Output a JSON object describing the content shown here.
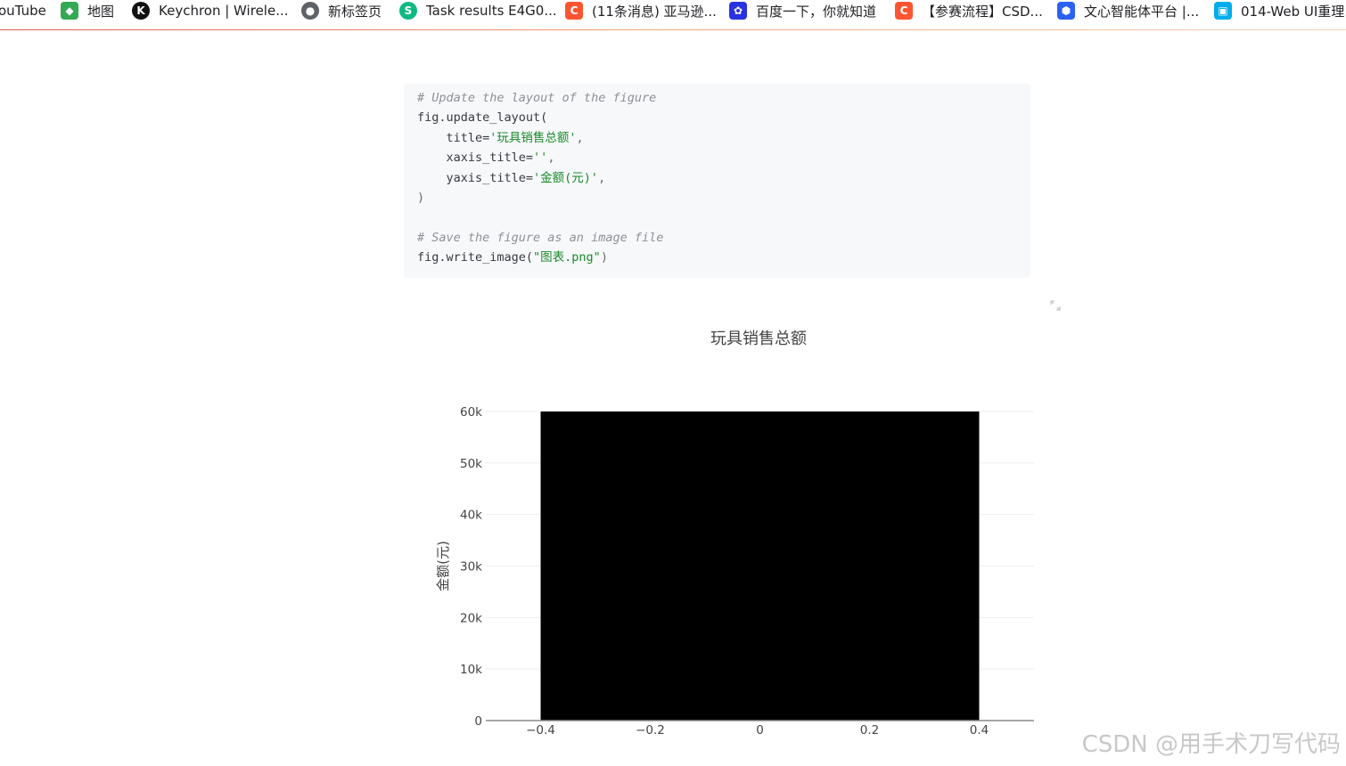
{
  "bookmarks": [
    {
      "label": "ouTube",
      "icon": "youtube-icon",
      "color": "#ff0000"
    },
    {
      "label": "地图",
      "icon": "maps-icon",
      "color": "#34a853"
    },
    {
      "label": "Keychron | Wirele...",
      "icon": "keychron-icon",
      "color": "#111111"
    },
    {
      "label": "新标签页",
      "icon": "globe-icon",
      "color": "#5f6368"
    },
    {
      "label": "Task results E4G0...",
      "icon": "task-icon",
      "color": "#10b981"
    },
    {
      "label": "(11条消息) 亚马逊...",
      "icon": "csdn-icon",
      "color": "#fc5531"
    },
    {
      "label": "百度一下，你就知道",
      "icon": "baidu-icon",
      "color": "#2932e1"
    },
    {
      "label": "【参赛流程】CSD...",
      "icon": "csdn-icon",
      "color": "#fc5531"
    },
    {
      "label": "文心智能体平台 |...",
      "icon": "wenxin-icon",
      "color": "#2b62f4"
    },
    {
      "label": "014-Web UI重理...",
      "icon": "bilibili-icon",
      "color": "#00aeec"
    }
  ],
  "code": {
    "comment1": "# Update the layout of the figure",
    "call1": "fig.update_layout(",
    "arg_title_key": "    title=",
    "arg_title_val": "'玩具销售总额'",
    "arg_x_key": "    xaxis_title=",
    "arg_x_val": "''",
    "arg_y_key": "    yaxis_title=",
    "arg_y_val": "'金额(元)'",
    "comma": ",",
    "close": ")",
    "comment2": "# Save the figure as an image file",
    "call2": "fig.write_image(",
    "call2_arg": "\"图表.png\"",
    "call2_close": ")"
  },
  "watermark": "CSDN @用手术刀写代码",
  "chart_data": {
    "type": "bar",
    "title": "玩具销售总额",
    "xlabel": "",
    "ylabel": "金额(元)",
    "x": [
      0
    ],
    "values": [
      60000
    ],
    "bar_width": 0.8,
    "xlim": [
      -0.5,
      0.5
    ],
    "ylim": [
      0,
      60000
    ],
    "xticks": [
      -0.4,
      -0.2,
      0,
      0.2,
      0.4
    ],
    "xtick_labels": [
      "−0.4",
      "−0.2",
      "0",
      "0.2",
      "0.4"
    ],
    "yticks": [
      0,
      10000,
      20000,
      30000,
      40000,
      50000,
      60000
    ],
    "ytick_labels": [
      "0",
      "10k",
      "20k",
      "30k",
      "40k",
      "50k",
      "60k"
    ],
    "bar_color": "#000000",
    "grid": true
  }
}
